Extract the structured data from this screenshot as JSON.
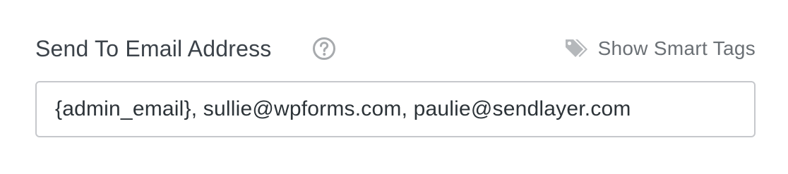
{
  "field": {
    "label": "Send To Email Address",
    "help_icon": "question-circle-icon",
    "smart_tags": {
      "icon": "tags-icon",
      "label": "Show Smart Tags"
    },
    "input": {
      "value": "{admin_email}, sullie@wpforms.com, paulie@sendlayer.com",
      "placeholder": ""
    }
  },
  "colors": {
    "label_text": "#3c434a",
    "muted_icon": "#a7aaad",
    "link_text": "#6b7075",
    "input_border": "#c6c8cc",
    "input_text": "#2c3338"
  }
}
